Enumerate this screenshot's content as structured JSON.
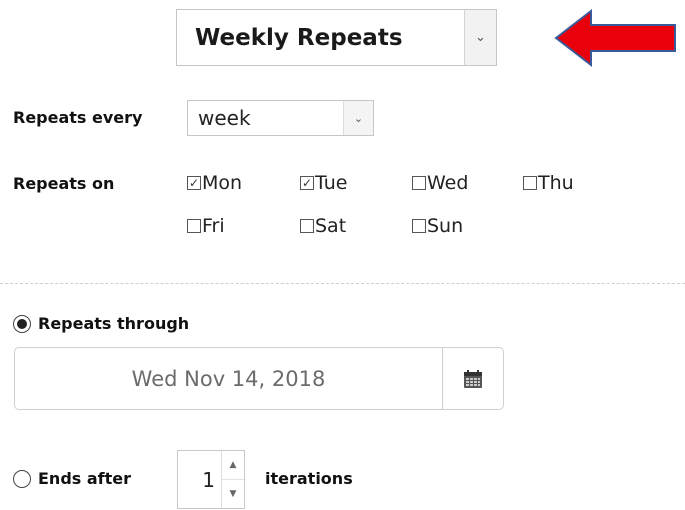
{
  "repeat_type": {
    "value": "Weekly Repeats"
  },
  "repeats_every": {
    "label": "Repeats every",
    "value": "week"
  },
  "repeats_on": {
    "label": "Repeats on",
    "days": [
      {
        "name": "Mon",
        "checked": true
      },
      {
        "name": "Tue",
        "checked": true
      },
      {
        "name": "Wed",
        "checked": false
      },
      {
        "name": "Thu",
        "checked": false
      },
      {
        "name": "Fri",
        "checked": false
      },
      {
        "name": "Sat",
        "checked": false
      },
      {
        "name": "Sun",
        "checked": false
      }
    ]
  },
  "repeats_through": {
    "label": "Repeats through",
    "selected": true,
    "date": "Wed Nov 14, 2018"
  },
  "ends_after": {
    "label": "Ends after",
    "selected": false,
    "count": "1",
    "suffix": "iterations"
  },
  "icons": {
    "dropdown": "chevron-down-icon",
    "calendar": "calendar-icon",
    "annotation": "red-arrow-icon"
  },
  "colors": {
    "annotation_arrow": "#e8000b",
    "annotation_outline": "#3a5a9a"
  }
}
